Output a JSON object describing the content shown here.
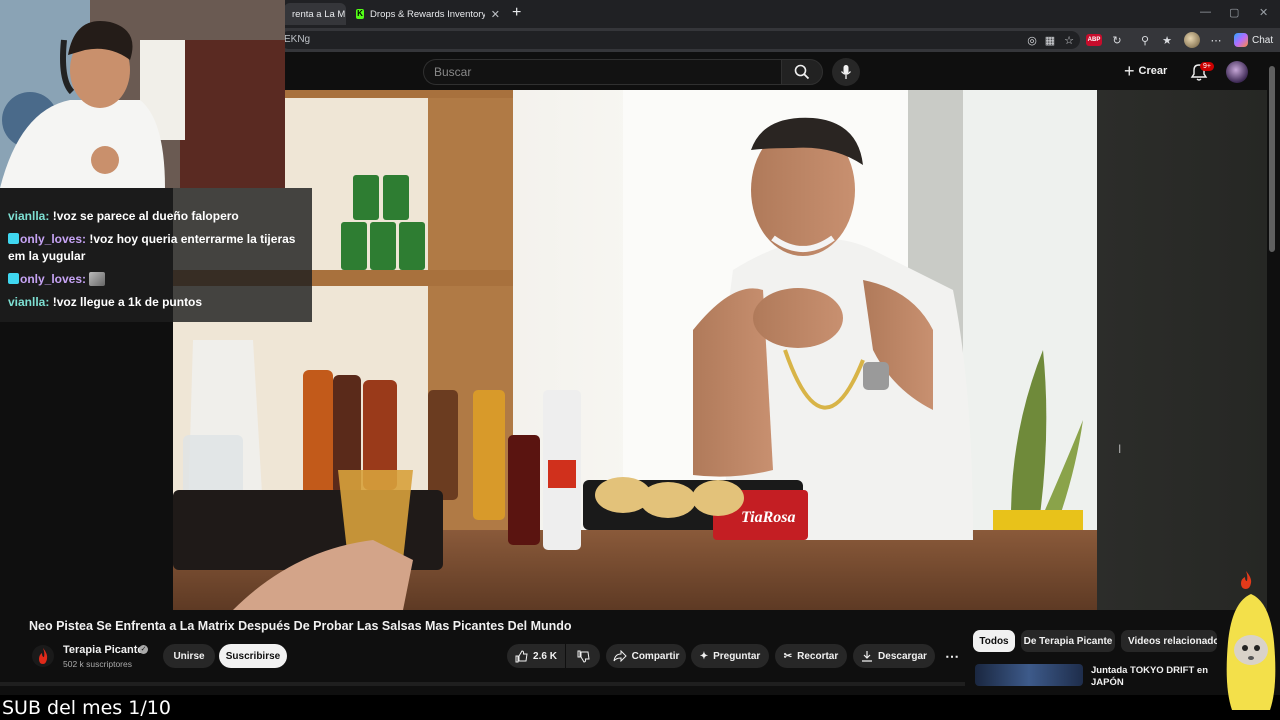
{
  "browser": {
    "tabs": [
      {
        "label": "renta a La M",
        "active": true
      },
      {
        "label": "Drops & Rewards Inventory - Kick",
        "active": false
      }
    ],
    "url_fragment": "EKNg",
    "chat_label": "Chat"
  },
  "youtube": {
    "search_placeholder": "Buscar",
    "create_label": "Crear",
    "notification_count": "9+"
  },
  "stream_chat": [
    {
      "user": "vianlla",
      "text": "!voz se parece al dueño falopero",
      "badge": false,
      "emote": false
    },
    {
      "user": "only_loves",
      "text": "!voz hoy queria enterrarme la tijeras em la yugular",
      "badge": true,
      "emote": false
    },
    {
      "user": "only_loves",
      "text": "",
      "badge": true,
      "emote": true
    },
    {
      "user": "vianlla",
      "text": "!voz llegue a 1k de puntos",
      "badge": false,
      "emote": false
    }
  ],
  "video": {
    "title": "Neo Pistea Se Enfrenta a La Matrix Después De Probar Las Salsas Mas Picantes Del Mundo",
    "channel": "Terapia Picante",
    "subscribers": "502 k suscriptores",
    "join_label": "Unirse",
    "subscribe_label": "Suscribirse",
    "likes": "2.6 K",
    "share_label": "Compartir",
    "ask_label": "Preguntar",
    "clip_label": "Recortar",
    "download_label": "Descargar",
    "sauce_label": "TiaRosa"
  },
  "sidebar": {
    "chips": [
      "Todos",
      "De Terapia Picante",
      "Videos relacionados"
    ],
    "recommendation_title": "Juntada TOKYO DRIFT en JAPÓN"
  },
  "overlay": {
    "sub_text": "SUB del mes 1/10"
  },
  "colors": {
    "background": "#0f0f0f",
    "youtube_red": "#ff0000",
    "kick_green": "#53fc18"
  }
}
